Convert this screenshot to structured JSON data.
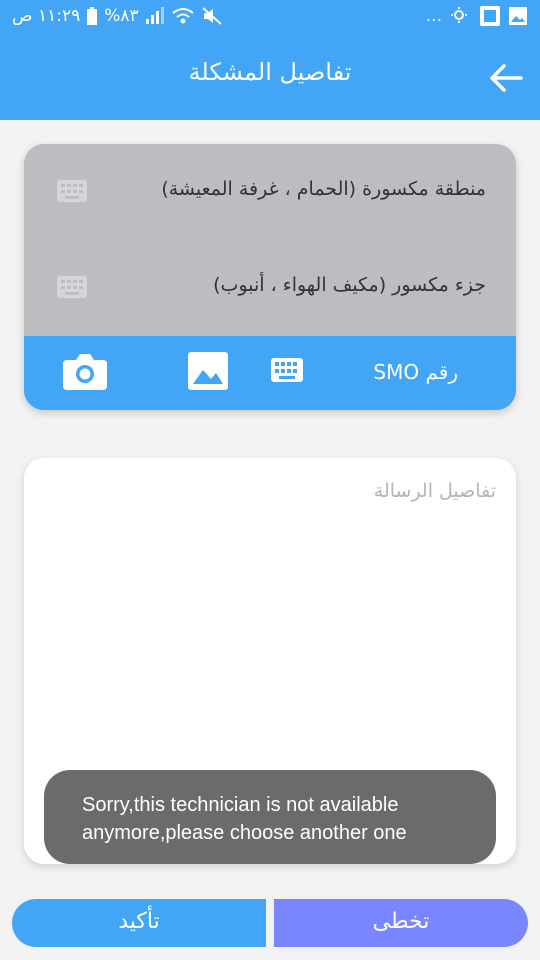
{
  "status_bar": {
    "time": "١١:٢٩ ص",
    "battery": "%٨٣",
    "more": "..."
  },
  "header": {
    "title": "تفاصيل المشكلة"
  },
  "form": {
    "broken_area_label": "منطقة مكسورة (الحمام ، غرفة المعيشة)",
    "broken_part_label": "جزء مكسور (مكيف الهواء ، أنبوب)",
    "smo_label": "رقم SMO"
  },
  "message": {
    "placeholder": "تفاصيل الرسالة",
    "value": ""
  },
  "toast": {
    "text": "Sorry,this technician is not available anymore,please choose another one"
  },
  "actions": {
    "confirm_label": "تأكيد",
    "skip_label": "تخطى"
  },
  "colors": {
    "primary": "#42a5f5",
    "secondary": "#7a86ff",
    "card_gray": "#bdbcc0",
    "toast": "#6b6b6b"
  }
}
